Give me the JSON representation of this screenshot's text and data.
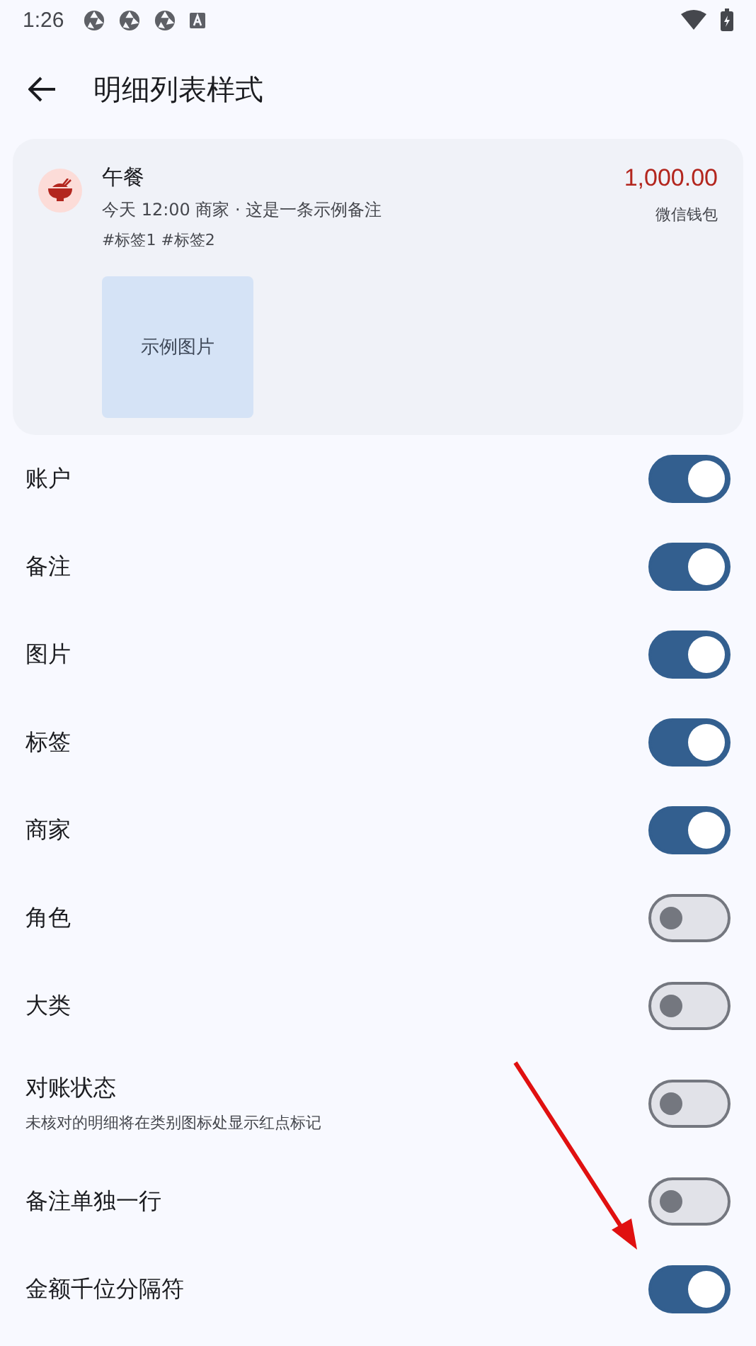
{
  "status_bar": {
    "time": "1:26"
  },
  "toolbar": {
    "title": "明细列表样式"
  },
  "preview": {
    "category": "午餐",
    "meta": "今天 12:00 商家 · 这是一条示例备注",
    "tags": "#标签1 #标签2",
    "image_label": "示例图片",
    "amount": "1,000.00",
    "account": "微信钱包"
  },
  "settings": [
    {
      "label": "账户",
      "on": true
    },
    {
      "label": "备注",
      "on": true
    },
    {
      "label": "图片",
      "on": true
    },
    {
      "label": "标签",
      "on": true
    },
    {
      "label": "商家",
      "on": true
    },
    {
      "label": "角色",
      "on": false
    },
    {
      "label": "大类",
      "on": false
    },
    {
      "label": "对账状态",
      "description": "未核对的明细将在类别图标处显示红点标记",
      "on": false
    },
    {
      "label": "备注单独一行",
      "on": false
    },
    {
      "label": "金额千位分隔符",
      "on": true
    }
  ]
}
